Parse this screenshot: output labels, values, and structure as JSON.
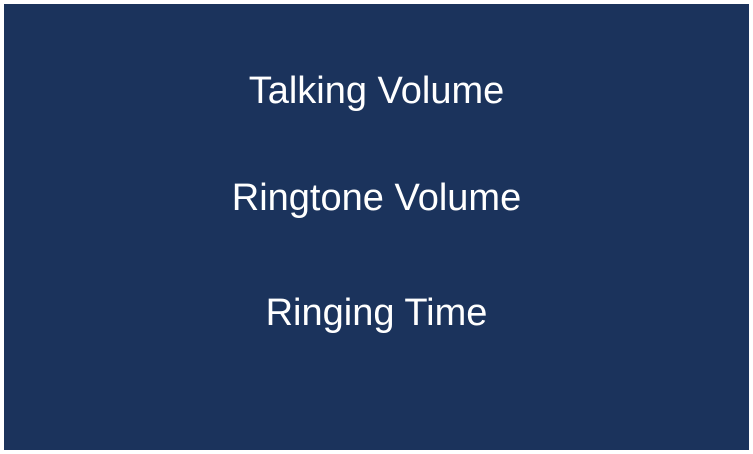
{
  "menu": {
    "items": [
      {
        "label": "Talking Volume"
      },
      {
        "label": "Ringtone Volume"
      },
      {
        "label": "Ringing Time"
      }
    ]
  },
  "colors": {
    "background": "#1b335c",
    "text": "#ffffff",
    "border": "#ffffff"
  }
}
